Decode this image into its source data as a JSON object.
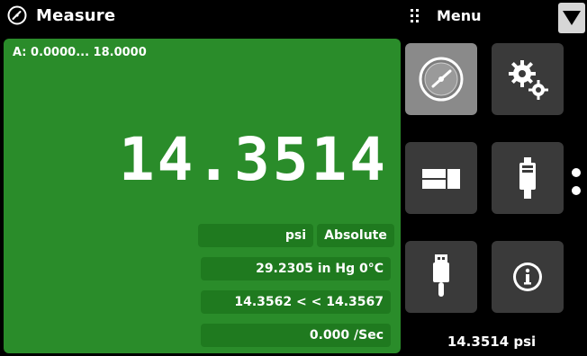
{
  "header": {
    "title": "Measure",
    "menu_label": "Menu"
  },
  "main": {
    "range": "A: 0.0000... 18.0000",
    "value": "14.3514",
    "unit": "psi",
    "mode": "Absolute",
    "secondary": "29.2305 in Hg 0°C",
    "peak": "14.3562 < < 14.3567",
    "rate": "0.000 /Sec"
  },
  "sidebar": {
    "tiles": [
      {
        "name": "gauge-icon",
        "active": true
      },
      {
        "name": "gears-icon",
        "active": false
      },
      {
        "name": "display-layout-icon",
        "active": false
      },
      {
        "name": "sensor-icon",
        "active": false
      },
      {
        "name": "usb-icon",
        "active": false
      },
      {
        "name": "info-icon",
        "active": false
      }
    ],
    "bottom_readout": "14.3514 psi"
  }
}
